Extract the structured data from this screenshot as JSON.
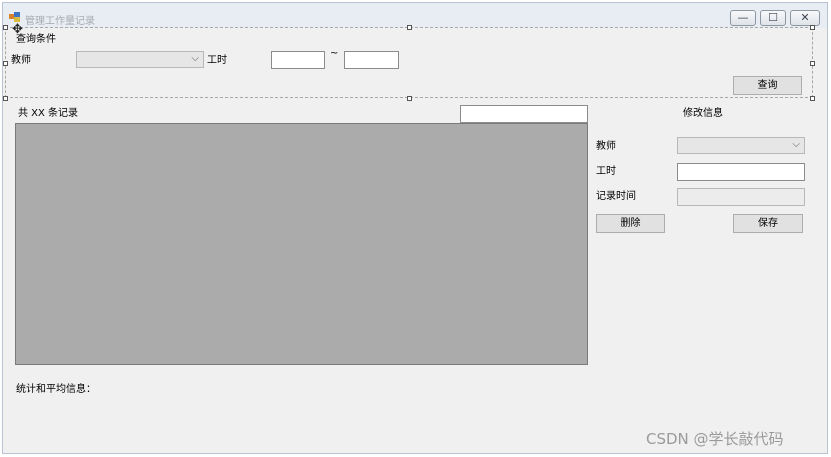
{
  "window": {
    "title": "管理工作量记录",
    "minimize_glyph": "—",
    "maximize_glyph": "☐",
    "close_glyph": "✕"
  },
  "query": {
    "group_label": "查询条件",
    "teacher_label": "教师",
    "teacher_value": "",
    "hours_label": "工时",
    "hours_from": "",
    "range_sep": "~",
    "hours_to": "",
    "search_button": "查询"
  },
  "records": {
    "count_label": "共 XX 条记录",
    "filter_value": ""
  },
  "edit": {
    "title": "修改信息",
    "teacher_label": "教师",
    "teacher_value": "",
    "hours_label": "工时",
    "hours_value": "",
    "time_label": "记录时间",
    "time_value": "",
    "delete_button": "删除",
    "save_button": "保存"
  },
  "stats_label": "统计和平均信息：",
  "watermark": "CSDN @学长敲代码",
  "icons": {
    "app": "app-icon",
    "move": "move-handle-icon",
    "dropdown": "chevron-down-icon"
  }
}
